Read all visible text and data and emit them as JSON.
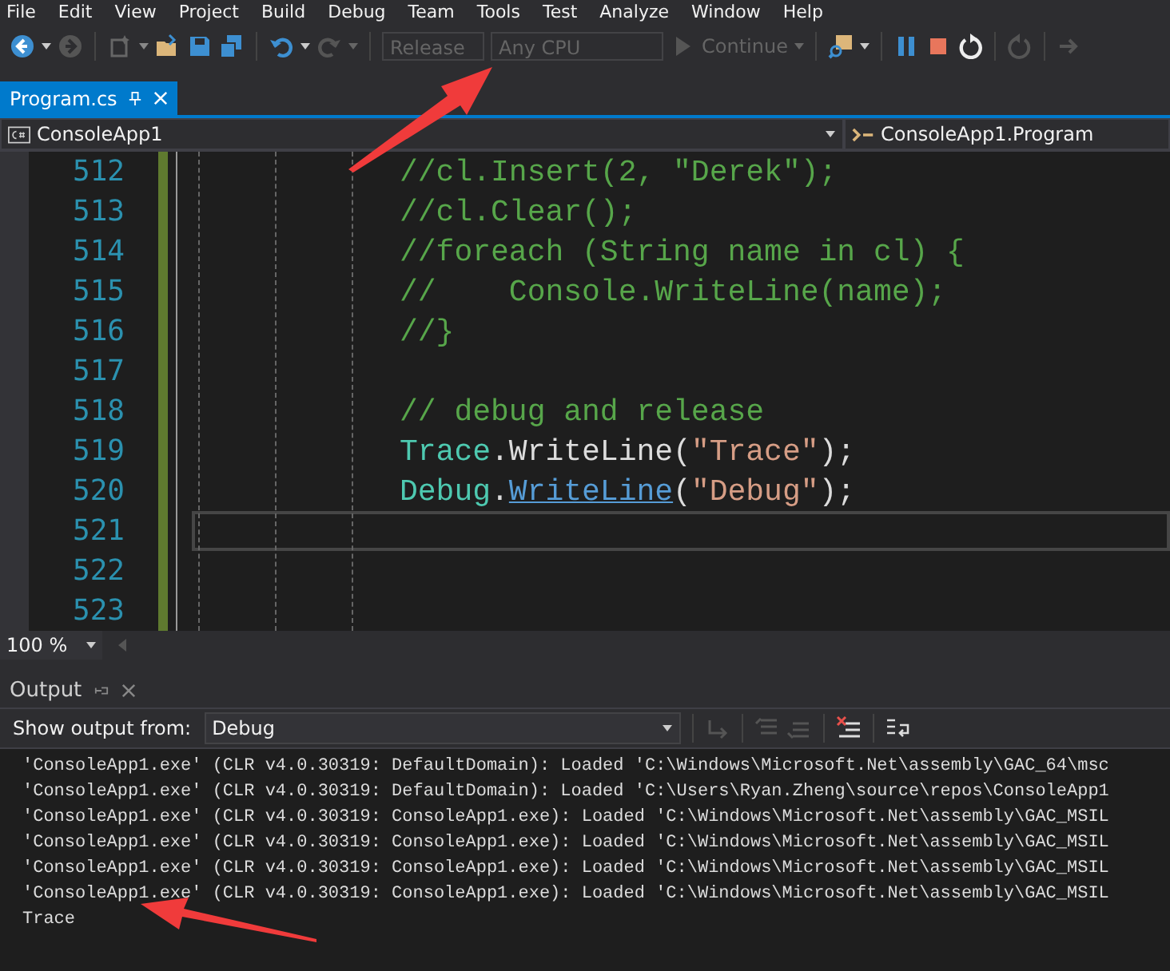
{
  "menu": [
    "File",
    "Edit",
    "View",
    "Project",
    "Build",
    "Debug",
    "Team",
    "Tools",
    "Test",
    "Analyze",
    "Window",
    "Help"
  ],
  "toolbar": {
    "configuration": {
      "value": "Release",
      "disabled": true
    },
    "platform": {
      "value": "Any CPU",
      "disabled": true
    },
    "continue": {
      "label": "Continue",
      "disabled": true
    }
  },
  "tabs": [
    {
      "label": "Program.cs",
      "selected": true
    }
  ],
  "navigation": {
    "project": "ConsoleApp1",
    "type": "ConsoleApp1.Program"
  },
  "editor": {
    "lines": [
      {
        "number": "512",
        "current": false,
        "tokens": [
          {
            "text": "//cl.Insert(2, \"Derek\");",
            "kind": "comment"
          }
        ]
      },
      {
        "number": "513",
        "current": false,
        "tokens": [
          {
            "text": "//cl.Clear();",
            "kind": "comment"
          }
        ]
      },
      {
        "number": "514",
        "current": false,
        "tokens": [
          {
            "text": "//foreach (String name in cl) {",
            "kind": "comment"
          }
        ]
      },
      {
        "number": "515",
        "current": false,
        "tokens": [
          {
            "text": "//    Console.WriteLine(name);",
            "kind": "comment"
          }
        ]
      },
      {
        "number": "516",
        "current": false,
        "tokens": [
          {
            "text": "//}",
            "kind": "comment"
          }
        ]
      },
      {
        "number": "517",
        "current": false
      },
      {
        "number": "518",
        "current": false,
        "tokens": [
          {
            "text": "// debug and release",
            "kind": "comment"
          }
        ]
      },
      {
        "number": "519",
        "current": false,
        "tokens": [
          {
            "text": "Trace",
            "kind": "type"
          },
          {
            "text": ".",
            "kind": "plain"
          },
          {
            "text": "WriteLine",
            "kind": "plain"
          },
          {
            "text": "(",
            "kind": "plain"
          },
          {
            "text": "\"Trace\"",
            "kind": "string"
          },
          {
            "text": ");",
            "kind": "plain"
          }
        ]
      },
      {
        "number": "520",
        "current": false,
        "tokens": [
          {
            "text": "Debug",
            "kind": "type"
          },
          {
            "text": ".",
            "kind": "plain"
          },
          {
            "text": "WriteLine",
            "kind": "link"
          },
          {
            "text": "(",
            "kind": "plain"
          },
          {
            "text": "\"Debug\"",
            "kind": "string"
          },
          {
            "text": ");",
            "kind": "plain"
          }
        ]
      },
      {
        "number": "521",
        "current": true
      },
      {
        "number": "522",
        "current": false
      },
      {
        "number": "523",
        "current": false
      }
    ]
  },
  "zoom": "100 %",
  "output": {
    "title": "Output",
    "source_label": "Show output from:",
    "source": "Debug",
    "lines": [
      "'ConsoleApp1.exe' (CLR v4.0.30319: DefaultDomain): Loaded 'C:\\Windows\\Microsoft.Net\\assembly\\GAC_64\\msc",
      "'ConsoleApp1.exe' (CLR v4.0.30319: DefaultDomain): Loaded 'C:\\Users\\Ryan.Zheng\\source\\repos\\ConsoleApp1",
      "'ConsoleApp1.exe' (CLR v4.0.30319: ConsoleApp1.exe): Loaded 'C:\\Windows\\Microsoft.Net\\assembly\\GAC_MSIL",
      "'ConsoleApp1.exe' (CLR v4.0.30319: ConsoleApp1.exe): Loaded 'C:\\Windows\\Microsoft.Net\\assembly\\GAC_MSIL",
      "'ConsoleApp1.exe' (CLR v4.0.30319: ConsoleApp1.exe): Loaded 'C:\\Windows\\Microsoft.Net\\assembly\\GAC_MSIL",
      "'ConsoleApp1.exe' (CLR v4.0.30319: ConsoleApp1.exe): Loaded 'C:\\Windows\\Microsoft.Net\\assembly\\GAC_MSIL",
      "Trace"
    ]
  }
}
